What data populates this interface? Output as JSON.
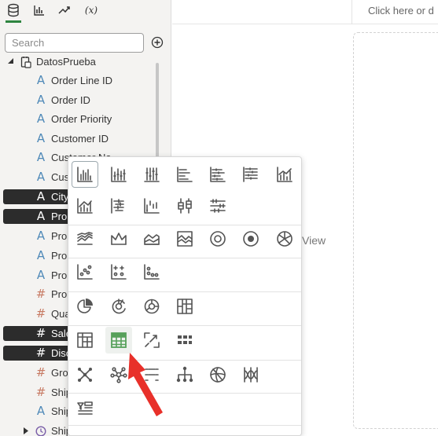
{
  "top_tabs": [
    {
      "name": "data-tab-icon",
      "active": true
    },
    {
      "name": "visualizations-tab-icon",
      "active": false
    },
    {
      "name": "analytics-tab-icon",
      "active": false
    },
    {
      "name": "calculations-tab",
      "label": "(x)",
      "active": false
    }
  ],
  "search": {
    "placeholder": "Search"
  },
  "tree": {
    "root_label": "DatosPrueba",
    "fields": [
      {
        "type": "attribute",
        "label": "Order Line ID",
        "selected": false
      },
      {
        "type": "attribute",
        "label": "Order ID",
        "selected": false
      },
      {
        "type": "attribute",
        "label": "Order Priority",
        "selected": false
      },
      {
        "type": "attribute",
        "label": "Customer ID",
        "selected": false
      },
      {
        "type": "attribute",
        "label": "Customer Na",
        "selected": false
      },
      {
        "type": "attribute",
        "label": "Cus",
        "selected": false
      },
      {
        "type": "attribute",
        "label": "City",
        "selected": true
      },
      {
        "type": "attribute",
        "label": "Pro",
        "selected": true
      },
      {
        "type": "attribute",
        "label": "Pro",
        "selected": false
      },
      {
        "type": "attribute",
        "label": "Pro",
        "selected": false
      },
      {
        "type": "attribute",
        "label": "Pro",
        "selected": false
      },
      {
        "type": "measure",
        "label": "Pro",
        "selected": false
      },
      {
        "type": "measure",
        "label": "Qua",
        "selected": false
      },
      {
        "type": "measure",
        "label": "Sale",
        "selected": true
      },
      {
        "type": "measure",
        "label": "Disc",
        "selected": true
      },
      {
        "type": "measure",
        "label": "Gro",
        "selected": false
      },
      {
        "type": "measure",
        "label": "Ship",
        "selected": false
      },
      {
        "type": "attribute",
        "label": "Ship",
        "selected": false
      },
      {
        "type": "time",
        "label": "Ship",
        "selected": false
      }
    ]
  },
  "canvas": {
    "title_hint": "Click here or d",
    "view_text": "View"
  },
  "colors": {
    "active_tab_underline": "#2e8540",
    "attribute_icon": "#4f89b8",
    "measure_icon": "#c77a63",
    "time_icon": "#7a5ea8",
    "selected_row_bg": "#2c2c2c",
    "arrow": "#e8302a",
    "table_icon_green": "#56a05a"
  },
  "visualizations": [
    [
      "bar-chart-icon",
      "stacked-bar-chart-icon",
      "percent-stacked-bar-icon",
      "horizontal-bar-icon",
      "horizontal-stacked-bar-icon",
      "horizontal-percent-bar-icon",
      "combo-bar-line-icon"
    ],
    [
      "bar-line-combo-icon",
      "horizontal-boxplot-icon",
      "waterfall-icon",
      "boxplot-icon",
      "horizontal-range-icon"
    ],
    [
      "line-chart-icon",
      "radar-line-icon",
      "radar-area-icon",
      "area-chart-icon",
      "donut-chart-icon",
      "sunburst-icon",
      "pie-segments-icon"
    ],
    [
      "scatter-chart-icon",
      "bubble-chart-icon",
      "dot-plot-icon"
    ],
    [
      "pie-chart-icon",
      "circle-pack-icon",
      "donut-gauge-icon",
      "treemap-icon"
    ],
    [
      "pivot-table-icon",
      "table-icon",
      "correlation-matrix-icon",
      "tile-grid-icon"
    ],
    [
      "network-icon",
      "cluster-network-icon",
      "parallel-coordinates-icon",
      "tree-diagram-icon",
      "chord-diagram-icon",
      "sankey-icon"
    ],
    [
      "list-filter-icon"
    ]
  ]
}
